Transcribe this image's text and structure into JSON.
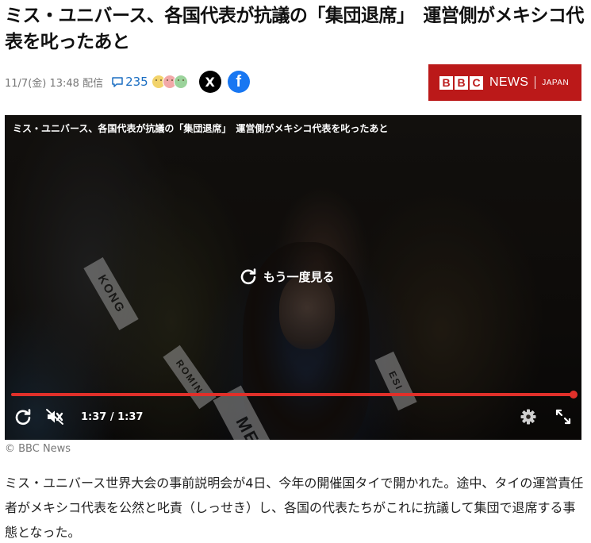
{
  "article": {
    "headline": "ミス・ユニバース、各国代表が抗議の「集団退席」　運営側がメキシコ代表を叱ったあと",
    "date": "11/7(金) 13:48 配信",
    "comment_count": "235",
    "share_x_label": "X",
    "share_fb_label": "f",
    "credit": "© BBC News",
    "body": "ミス・ユニバース世界大会の事前説明会が4日、今年の開催国タイで開かれた。途中、タイの運営責任者がメキシコ代表を公然と叱責（しっせき）し、各国の代表たちがこれに抗議して集団で退席する事態となった。"
  },
  "logo": {
    "blocks": [
      "B",
      "B",
      "C"
    ],
    "news": "NEWS",
    "japan": "JAPAN",
    "color": "#bb1919"
  },
  "video": {
    "title": "ミス・ユニバース、各国代表が抗議の「集団退席」　運営側がメキシコ代表を叱ったあと",
    "replay_label": "もう一度見る",
    "time": "1:37 / 1:37",
    "progress": 1.0,
    "sashes": {
      "mexico": "MEXICO",
      "kong": "KONG",
      "romin": "ROMIN",
      "esi": "ESI"
    },
    "accent_color": "#e0302a"
  },
  "icons": {
    "comment": "comment-icon",
    "replay": "replay-icon",
    "mute": "mute-icon",
    "settings": "gear-icon",
    "fullscreen": "fullscreen-icon"
  },
  "reaction_colors": [
    "#f2d36b",
    "#f2a8a8",
    "#9bd39b"
  ]
}
